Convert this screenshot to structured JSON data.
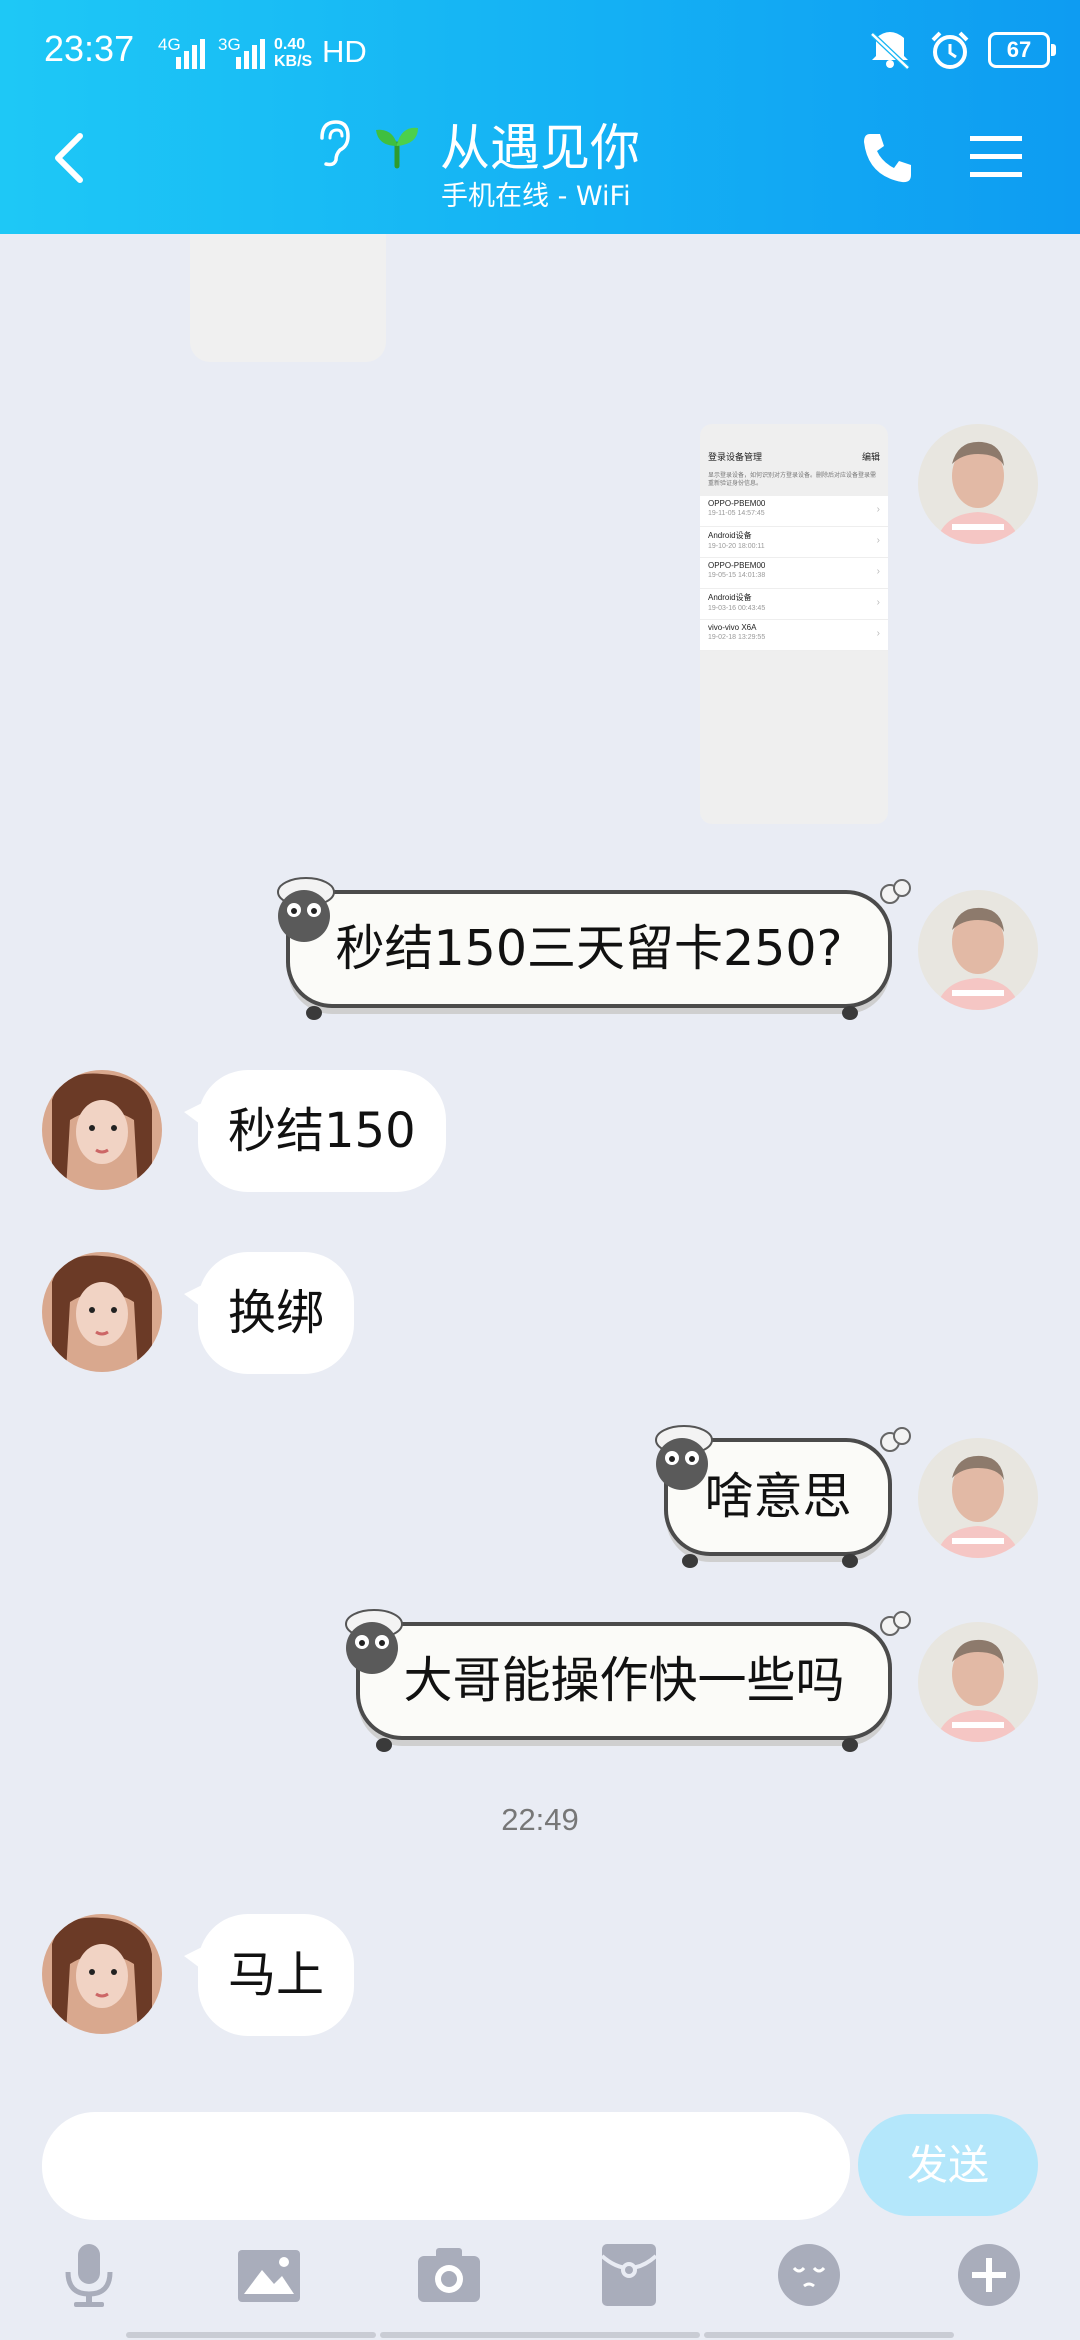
{
  "status_bar": {
    "time": "23:37",
    "net1": "4G",
    "net2": "3G",
    "speed_top": "0.40",
    "speed_bottom": "KB/S",
    "hd": "HD",
    "battery": "67"
  },
  "header": {
    "contact_name": "从遇见你",
    "status": "手机在线 - WiFi"
  },
  "screenshot_card": {
    "title": "登录设备管理",
    "action": "编辑",
    "note": "显示登录设备，如何识别对方登录设备。删除后对应设备登录需重新验证身份信息。",
    "devices": [
      {
        "name": "OPPO-PBEM00",
        "time": "19-11-05 14:57:45"
      },
      {
        "name": "Android设备",
        "time": "19-10-20 18:00:11"
      },
      {
        "name": "OPPO-PBEM00",
        "time": "19-05-15 14:01:38"
      },
      {
        "name": "Android设备",
        "time": "19-03-16 00:43:45"
      },
      {
        "name": "vivo-vivo X6A",
        "time": "19-02-18 13:29:55"
      }
    ]
  },
  "messages": [
    {
      "side": "right",
      "text": "秒结150三天留卡250?"
    },
    {
      "side": "left",
      "text": "秒结150"
    },
    {
      "side": "left",
      "text": "换绑"
    },
    {
      "side": "right",
      "text": "啥意思"
    },
    {
      "side": "right",
      "text": "大哥能操作快一些吗"
    },
    {
      "side": "left",
      "text": "马上"
    }
  ],
  "timestamp": "22:49",
  "input": {
    "placeholder": "",
    "send_label": "发送"
  },
  "colors": {
    "header_start": "#1ec8f6",
    "header_end": "#0e9cf2",
    "chat_bg": "#e9ecf4",
    "send_btn": "#b4e7fb"
  }
}
